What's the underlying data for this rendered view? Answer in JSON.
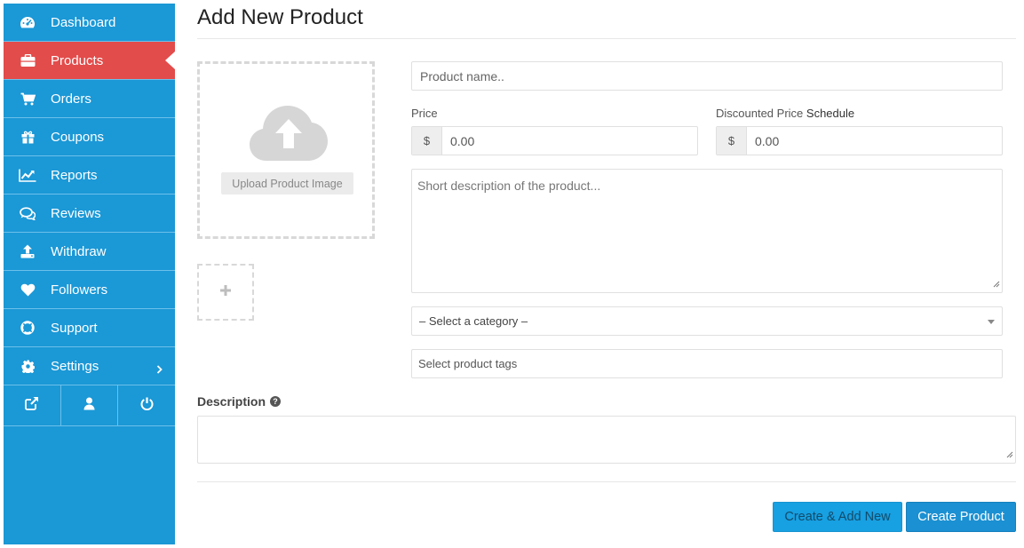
{
  "sidebar": {
    "items": [
      {
        "label": "Dashboard",
        "icon": "tachometer-icon",
        "active": false
      },
      {
        "label": "Products",
        "icon": "briefcase-icon",
        "active": true
      },
      {
        "label": "Orders",
        "icon": "shopping-cart-icon",
        "active": false
      },
      {
        "label": "Coupons",
        "icon": "gift-icon",
        "active": false
      },
      {
        "label": "Reports",
        "icon": "line-chart-icon",
        "active": false
      },
      {
        "label": "Reviews",
        "icon": "comments-icon",
        "active": false
      },
      {
        "label": "Withdraw",
        "icon": "upload-icon",
        "active": false
      },
      {
        "label": "Followers",
        "icon": "heart-icon",
        "active": false
      },
      {
        "label": "Support",
        "icon": "life-ring-icon",
        "active": false
      },
      {
        "label": "Settings",
        "icon": "gear-icon",
        "active": false
      }
    ],
    "footer_icons": [
      "external-link-icon",
      "user-icon",
      "power-icon"
    ]
  },
  "page": {
    "title": "Add New Product"
  },
  "upload": {
    "button_label": "Upload Product Image"
  },
  "form": {
    "product_name_placeholder": "Product name..",
    "price_label": "Price",
    "price_currency": "$",
    "price_value": "0.00",
    "discount_label": "Discounted Price",
    "discount_schedule": "Schedule",
    "discount_currency": "$",
    "discount_value": "0.00",
    "short_desc_placeholder": "Short description of the product...",
    "category_selected": "– Select a category –",
    "tags_placeholder": "Select product tags",
    "description_label": "Description"
  },
  "actions": {
    "create_add_new": "Create & Add New",
    "create_product": "Create Product"
  },
  "colors": {
    "sidebar_bg": "#1b98d6",
    "active_bg": "#e24c4b",
    "primary_button": "#1b90d2"
  }
}
